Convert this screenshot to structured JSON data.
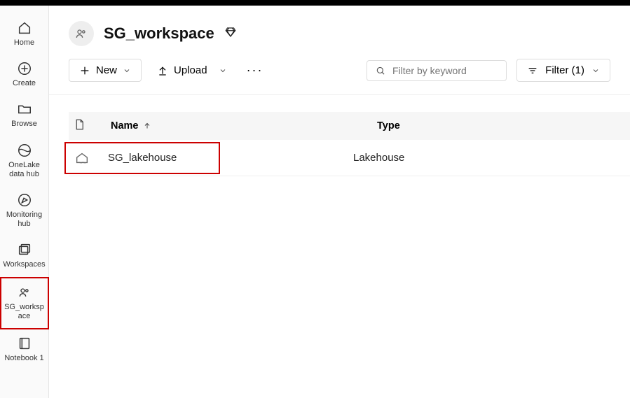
{
  "sidebar": {
    "items": [
      {
        "label": "Home"
      },
      {
        "label": "Create"
      },
      {
        "label": "Browse"
      },
      {
        "label": "OneLake data hub"
      },
      {
        "label": "Monitoring hub"
      },
      {
        "label": "Workspaces"
      },
      {
        "label": "SG_workspace"
      },
      {
        "label": "Notebook 1"
      }
    ]
  },
  "workspace": {
    "title": "SG_workspace"
  },
  "toolbar": {
    "new_label": "New",
    "upload_label": "Upload"
  },
  "search": {
    "placeholder": "Filter by keyword"
  },
  "filter": {
    "label": "Filter (1)"
  },
  "table": {
    "columns": {
      "name": "Name",
      "type": "Type"
    },
    "rows": [
      {
        "name": "SG_lakehouse",
        "type": "Lakehouse"
      }
    ]
  }
}
